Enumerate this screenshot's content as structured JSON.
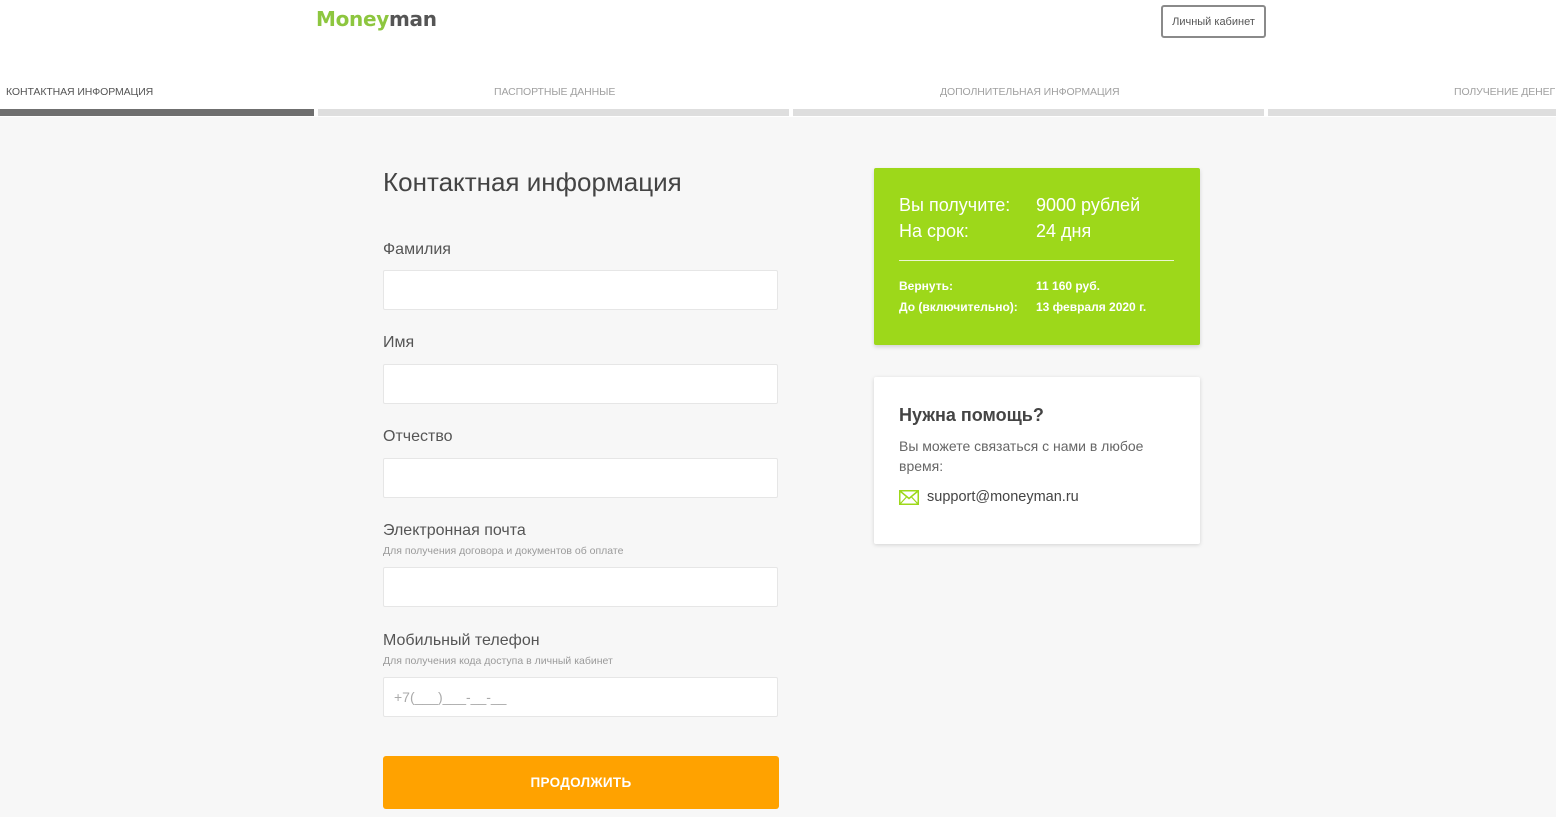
{
  "header": {
    "logo_part1": "Money",
    "logo_part2": "man",
    "cabinet_button": "Личный кабинет"
  },
  "steps": [
    {
      "label": "Контактная информация",
      "active": true
    },
    {
      "label": "Паспортные данные",
      "active": false
    },
    {
      "label": "Дополнительная информация",
      "active": false
    },
    {
      "label": "Получение денег",
      "active": false
    }
  ],
  "form": {
    "title": "Контактная информация",
    "fields": {
      "lastname": {
        "label": "Фамилия",
        "value": "",
        "placeholder": ""
      },
      "firstname": {
        "label": "Имя",
        "value": "",
        "placeholder": ""
      },
      "patronymic": {
        "label": "Отчество",
        "value": "",
        "placeholder": ""
      },
      "email": {
        "label": "Электронная почта",
        "hint": "Для получения договора и документов об оплате",
        "value": "",
        "placeholder": ""
      },
      "phone": {
        "label": "Мобильный телефон",
        "hint": "Для получения кода доступа в личный кабинет",
        "value": "",
        "placeholder": "+7(___)___-__-__"
      }
    },
    "submit_label": "Продолжить"
  },
  "loan_summary": {
    "receive_label": "Вы получите:",
    "receive_value": "9000 рублей",
    "term_label": "На срок:",
    "term_value": "24 дня",
    "return_label": "Вернуть:",
    "return_value": "11 160 руб.",
    "until_label": "До (включительно):",
    "until_value": "13 февраля 2020 г."
  },
  "help": {
    "title": "Нужна помощь?",
    "text": "Вы можете связаться с нами в любое время:",
    "email": "support@moneyman.ru"
  },
  "colors": {
    "brand_green": "#9dd81a",
    "accent_orange": "#ffa200",
    "active_step_bar": "#6f6f6f"
  }
}
